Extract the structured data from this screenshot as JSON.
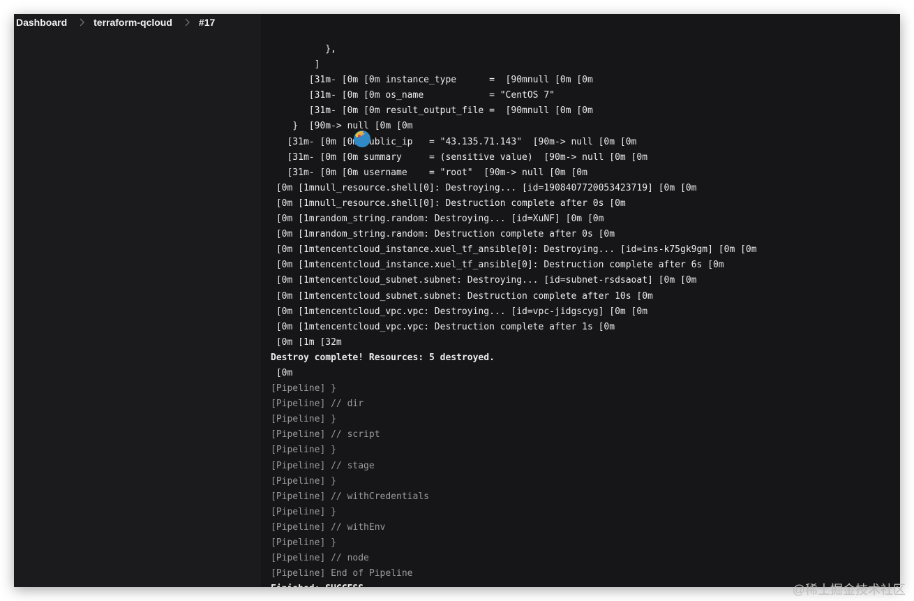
{
  "breadcrumb": {
    "items": [
      "Dashboard",
      "terraform-qcloud",
      "#17"
    ]
  },
  "icons": {
    "separator": "chevron-right-icon",
    "avatar": "avatar-icon"
  },
  "colors": {
    "background": "#161618",
    "text": "#ececec",
    "pipeline_text": "#9a9a9a",
    "avatar_blue": "#2f8ac6",
    "avatar_yellow": "#f2c132"
  },
  "console": {
    "lines": [
      {
        "text": "          },",
        "style": "normal"
      },
      {
        "text": "        ]",
        "style": "normal"
      },
      {
        "text": "       [31m- [0m [0m instance_type      =  [90mnull [0m [0m",
        "style": "normal"
      },
      {
        "text": "       [31m- [0m [0m os_name            = \"CentOS 7\"",
        "style": "normal"
      },
      {
        "text": "       [31m- [0m [0m result_output_file =  [90mnull [0m [0m",
        "style": "normal"
      },
      {
        "text": "    }  [90m-> null [0m [0m",
        "style": "normal"
      },
      {
        "text": "   [31m- [0m [0m public_ip   = \"43.135.71.143\"  [90m-> null [0m [0m",
        "style": "normal"
      },
      {
        "text": "   [31m- [0m [0m summary     = (sensitive value)  [90m-> null [0m [0m",
        "style": "normal"
      },
      {
        "text": "   [31m- [0m [0m username    = \"root\"  [90m-> null [0m [0m",
        "style": "normal"
      },
      {
        "text": " [0m [1mnull_resource.shell[0]: Destroying... [id=1908407720053423719] [0m [0m",
        "style": "normal"
      },
      {
        "text": " [0m [1mnull_resource.shell[0]: Destruction complete after 0s [0m",
        "style": "normal"
      },
      {
        "text": " [0m [1mrandom_string.random: Destroying... [id=XuNF] [0m [0m",
        "style": "normal"
      },
      {
        "text": " [0m [1mrandom_string.random: Destruction complete after 0s [0m",
        "style": "normal"
      },
      {
        "text": " [0m [1mtencentcloud_instance.xuel_tf_ansible[0]: Destroying... [id=ins-k75gk9gm] [0m [0m",
        "style": "normal"
      },
      {
        "text": " [0m [1mtencentcloud_instance.xuel_tf_ansible[0]: Destruction complete after 6s [0m",
        "style": "normal"
      },
      {
        "text": " [0m [1mtencentcloud_subnet.subnet: Destroying... [id=subnet-rsdsaoat] [0m [0m",
        "style": "normal"
      },
      {
        "text": " [0m [1mtencentcloud_subnet.subnet: Destruction complete after 10s [0m",
        "style": "normal"
      },
      {
        "text": " [0m [1mtencentcloud_vpc.vpc: Destroying... [id=vpc-jidgscyg] [0m [0m",
        "style": "normal"
      },
      {
        "text": " [0m [1mtencentcloud_vpc.vpc: Destruction complete after 1s [0m",
        "style": "normal"
      },
      {
        "text": " [0m [1m [32m",
        "style": "normal"
      },
      {
        "text": "Destroy complete! Resources: 5 destroyed.",
        "style": "bold"
      },
      {
        "text": " [0m",
        "style": "normal"
      },
      {
        "text": "[Pipeline] }",
        "style": "pipeline"
      },
      {
        "text": "[Pipeline] // dir",
        "style": "pipeline"
      },
      {
        "text": "[Pipeline] }",
        "style": "pipeline"
      },
      {
        "text": "[Pipeline] // script",
        "style": "pipeline"
      },
      {
        "text": "[Pipeline] }",
        "style": "pipeline"
      },
      {
        "text": "[Pipeline] // stage",
        "style": "pipeline"
      },
      {
        "text": "[Pipeline] }",
        "style": "pipeline"
      },
      {
        "text": "[Pipeline] // withCredentials",
        "style": "pipeline"
      },
      {
        "text": "[Pipeline] }",
        "style": "pipeline"
      },
      {
        "text": "[Pipeline] // withEnv",
        "style": "pipeline"
      },
      {
        "text": "[Pipeline] }",
        "style": "pipeline"
      },
      {
        "text": "[Pipeline] // node",
        "style": "pipeline"
      },
      {
        "text": "[Pipeline] End of Pipeline",
        "style": "pipeline"
      },
      {
        "text": "Finished: SUCCESS",
        "style": "bold"
      }
    ]
  },
  "watermark": "@稀土掘金技术社区"
}
